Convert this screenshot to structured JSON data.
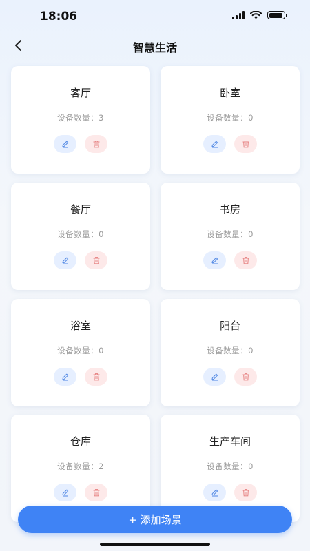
{
  "status": {
    "time": "18:06"
  },
  "nav": {
    "title": "智慧生活"
  },
  "scenes": [
    {
      "name": "客厅",
      "count_text": "设备数量：3"
    },
    {
      "name": "卧室",
      "count_text": "设备数量：0"
    },
    {
      "name": "餐厅",
      "count_text": "设备数量：0"
    },
    {
      "name": "书房",
      "count_text": "设备数量：0"
    },
    {
      "name": "浴室",
      "count_text": "设备数量：0"
    },
    {
      "name": "阳台",
      "count_text": "设备数量：0"
    },
    {
      "name": "仓库",
      "count_text": "设备数量：2"
    },
    {
      "name": "生产车间",
      "count_text": "设备数量：0"
    }
  ],
  "add_button": {
    "label": "+ 添加场景"
  },
  "colors": {
    "accent": "#3f83f5",
    "edit_bg": "#e6efff",
    "delete_bg": "#fde9e9",
    "edit_icon": "#5b8fe6",
    "delete_icon": "#e88a8a"
  }
}
